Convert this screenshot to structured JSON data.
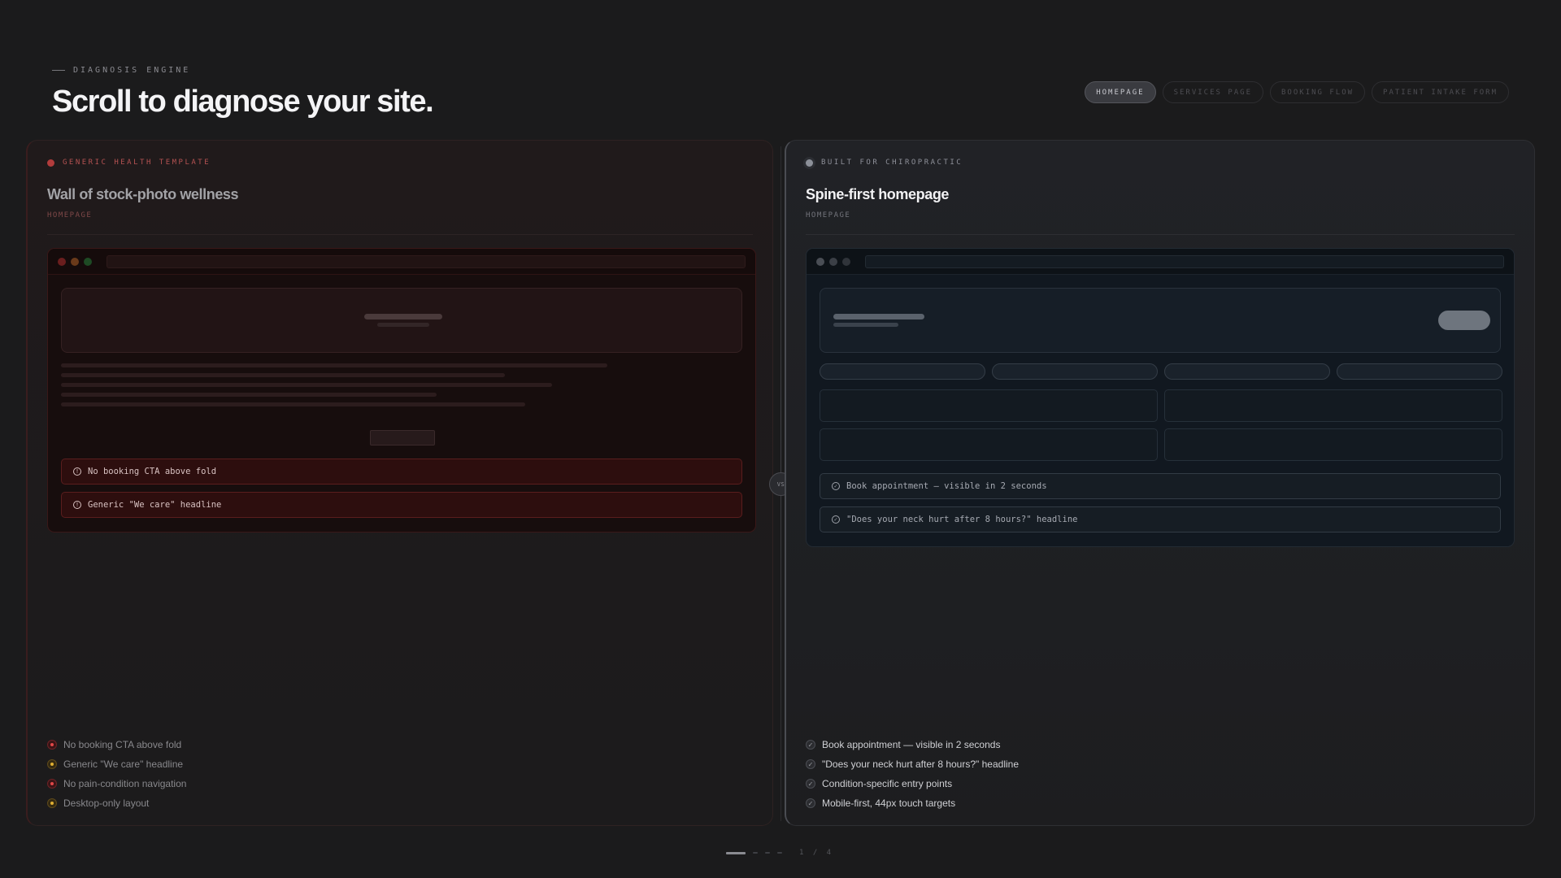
{
  "header": {
    "eyebrow": "DIAGNOSIS ENGINE",
    "title": "Scroll to diagnose your site."
  },
  "tabs": [
    {
      "label": "HOMEPAGE",
      "active": true
    },
    {
      "label": "SERVICES PAGE",
      "active": false
    },
    {
      "label": "BOOKING FLOW",
      "active": false
    },
    {
      "label": "PATIENT INTAKE FORM",
      "active": false
    }
  ],
  "left_panel": {
    "badge": "GENERIC HEALTH TEMPLATE",
    "title": "Wall of stock-photo wellness",
    "subtitle": "HOMEPAGE",
    "mock_issues": [
      "No booking CTA above fold",
      "Generic \"We care\" headline"
    ],
    "list": [
      {
        "text": "No booking CTA above fold",
        "severity": "red"
      },
      {
        "text": "Generic \"We care\" headline",
        "severity": "amber"
      },
      {
        "text": "No pain-condition navigation",
        "severity": "red"
      },
      {
        "text": "Desktop-only layout",
        "severity": "amber"
      }
    ]
  },
  "right_panel": {
    "badge": "BUILT FOR CHIROPRACTIC",
    "title": "Spine-first homepage",
    "subtitle": "HOMEPAGE",
    "mock_issues": [
      "Book appointment — visible in 2 seconds",
      "\"Does your neck hurt after 8 hours?\" headline"
    ],
    "list": [
      {
        "text": "Book appointment — visible in 2 seconds"
      },
      {
        "text": "\"Does your neck hurt after 8 hours?\" headline"
      },
      {
        "text": "Condition-specific entry points"
      },
      {
        "text": "Mobile-first, 44px touch targets"
      }
    ]
  },
  "divider": {
    "label": "VS"
  },
  "pager": {
    "current": 1,
    "total": 4,
    "label": "1 / 4"
  },
  "colors": {
    "background": "#1b1b1c",
    "left_accent": "#b23c3c",
    "right_accent": "#8c9099",
    "issue_red": "#e24848",
    "issue_amber": "#e0b032"
  },
  "icons": {
    "issue_icon": "alert-circle-icon",
    "check_icon": "check-circle-icon"
  }
}
